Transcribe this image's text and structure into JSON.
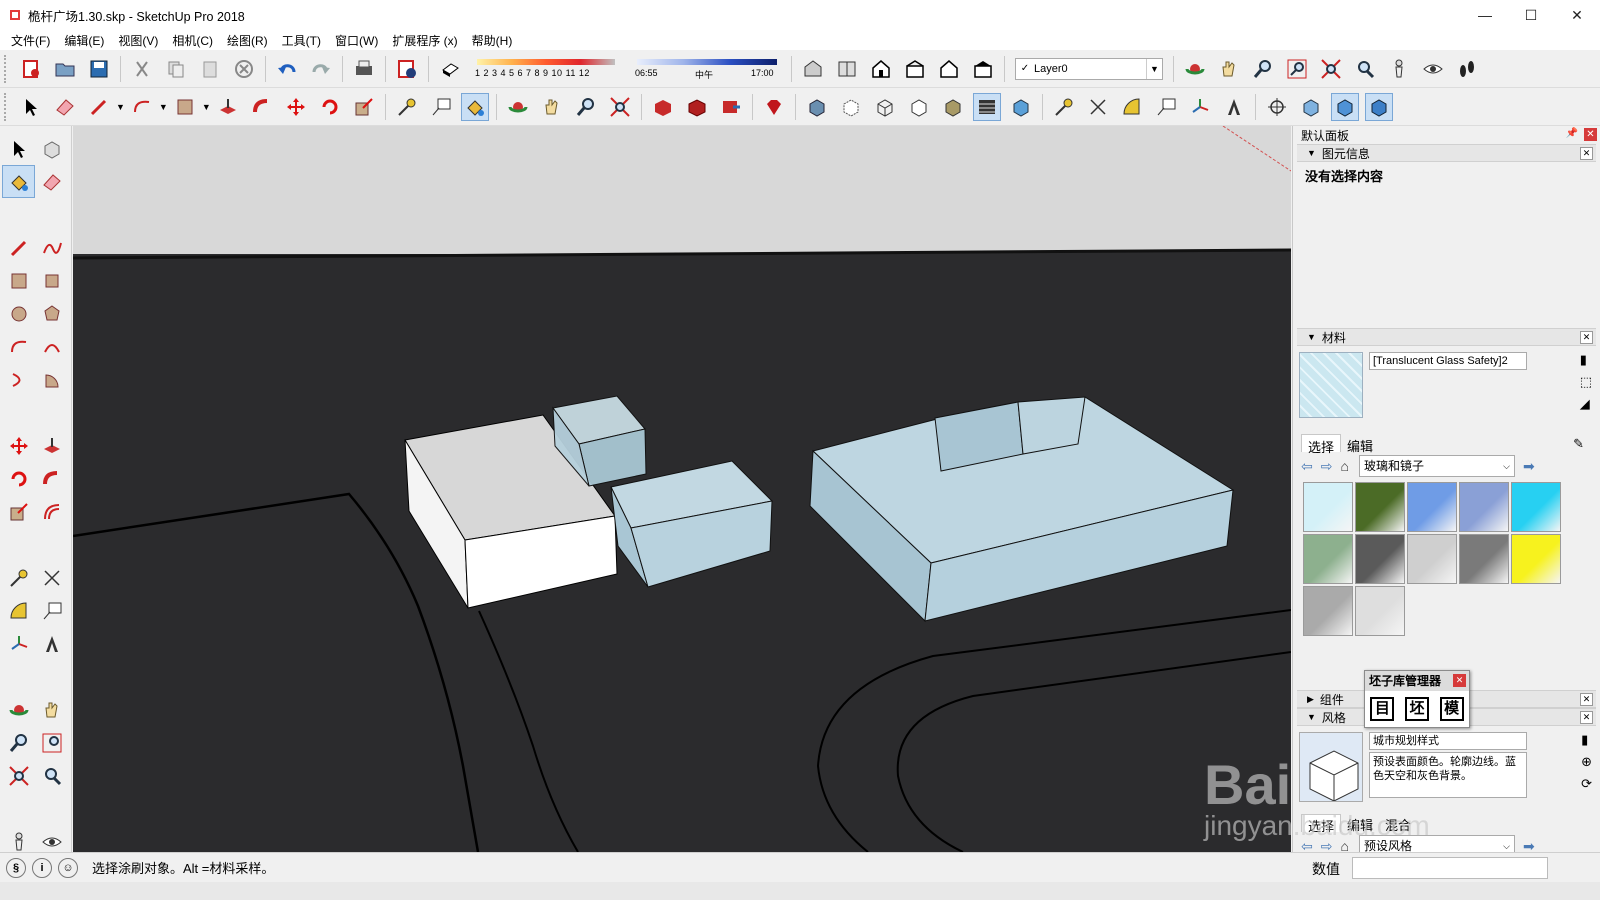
{
  "window": {
    "title": "桅杆广场1.30.skp - SketchUp Pro 2018",
    "minimize": "—",
    "maximize": "☐",
    "close": "✕"
  },
  "menu": [
    "文件(F)",
    "编辑(E)",
    "视图(V)",
    "相机(C)",
    "绘图(R)",
    "工具(T)",
    "窗口(W)",
    "扩展程序 (x)",
    "帮助(H)"
  ],
  "toolbar": {
    "shadow_months": "1 2 3 4 5 6 7 8 9 10 11 12",
    "time_start": "06:55",
    "time_mid": "中午",
    "time_end": "17:00",
    "layer": "Layer0",
    "layer_check": "✓"
  },
  "panel": {
    "title": "默认面板",
    "entity_info": {
      "head": "图元信息",
      "empty": "没有选择内容"
    },
    "materials": {
      "head": "材料",
      "current_name": "[Translucent Glass Safety]2",
      "tab_select": "选择",
      "tab_edit": "编辑",
      "collection": "玻璃和镜子",
      "swatch_colors": [
        "#d4f1f8",
        "#4b6b26",
        "#6f9ce6",
        "#8aa0d6",
        "#27d0f2",
        "#8db08e",
        "#5a5a5a",
        "#cfcfcf",
        "#7a7a7a",
        "#f7f21e",
        "#aaaaaa",
        "#dedede"
      ]
    },
    "components": {
      "head": "组件"
    },
    "styles": {
      "head": "风格",
      "name": "城市规划样式",
      "description": "预设表面颜色。轮廓边线。蓝色天空和灰色背景。",
      "tab_select": "选择",
      "tab_edit": "编辑",
      "tab_mix": "混合",
      "collection": "预设风格"
    }
  },
  "floating": {
    "title": "坯子库管理器",
    "buttons": [
      "目",
      "坯",
      "模"
    ]
  },
  "status": {
    "message": "选择涂刷对象。Alt =材料采样。",
    "vcb_label": "数值"
  },
  "watermark": {
    "brand": "Bai",
    "site": "jingyan.baidu.com"
  },
  "colors": {
    "viewport_bg": "#2b2b2d",
    "sky": "#d8d8d8",
    "glass": "#c9dfe8",
    "white_box": "#f4f4f4"
  }
}
